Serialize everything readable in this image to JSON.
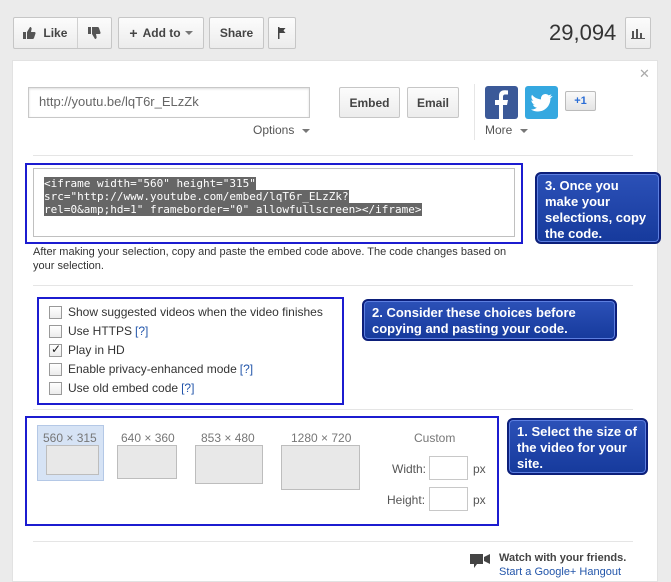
{
  "toolbar": {
    "like_label": "Like",
    "add_to_label": "Add to",
    "share_label": "Share"
  },
  "views": "29,094",
  "share": {
    "url": "http://youtu.be/lqT6r_ELzZk",
    "options_label": "Options",
    "embed_label": "Embed",
    "email_label": "Email",
    "more_label": "More",
    "gplus_label": "+1"
  },
  "embed": {
    "code_lines": [
      "<iframe width=\"560\" height=\"315\"",
      "src=\"http://www.youtube.com/embed/lqT6r_ELzZk?",
      "rel=0&amp;hd=1\" frameborder=\"0\" allowfullscreen></iframe>"
    ],
    "note": "After making your selection, copy and paste the embed code above. The code changes based on your selection."
  },
  "options": [
    {
      "label": "Show suggested videos when the video finishes",
      "checked": false,
      "help": ""
    },
    {
      "label": "Use HTTPS",
      "checked": false,
      "help": "[?]"
    },
    {
      "label": "Play in HD",
      "checked": true,
      "help": ""
    },
    {
      "label": "Enable privacy-enhanced mode",
      "checked": false,
      "help": "[?]"
    },
    {
      "label": "Use old embed code",
      "checked": false,
      "help": "[?]"
    }
  ],
  "sizes": [
    {
      "label": "560 × 315",
      "selected": true
    },
    {
      "label": "640 × 360",
      "selected": false
    },
    {
      "label": "853 × 480",
      "selected": false
    },
    {
      "label": "1280 × 720",
      "selected": false
    }
  ],
  "custom": {
    "label": "Custom",
    "width_label": "Width:",
    "height_label": "Height:",
    "unit": "px"
  },
  "callouts": {
    "step1": "1. Select the size of the video for your site.",
    "step2": "2. Consider these choices before copying and pasting your code.",
    "step3": "3. Once you make your selections, copy the code."
  },
  "hangout": {
    "title": "Watch with your friends.",
    "link": "Start a Google+ Hangout"
  },
  "colors": {
    "annotation": "#1c1cd0",
    "callout_bg": "#1f45ae",
    "link": "#2255aa"
  }
}
